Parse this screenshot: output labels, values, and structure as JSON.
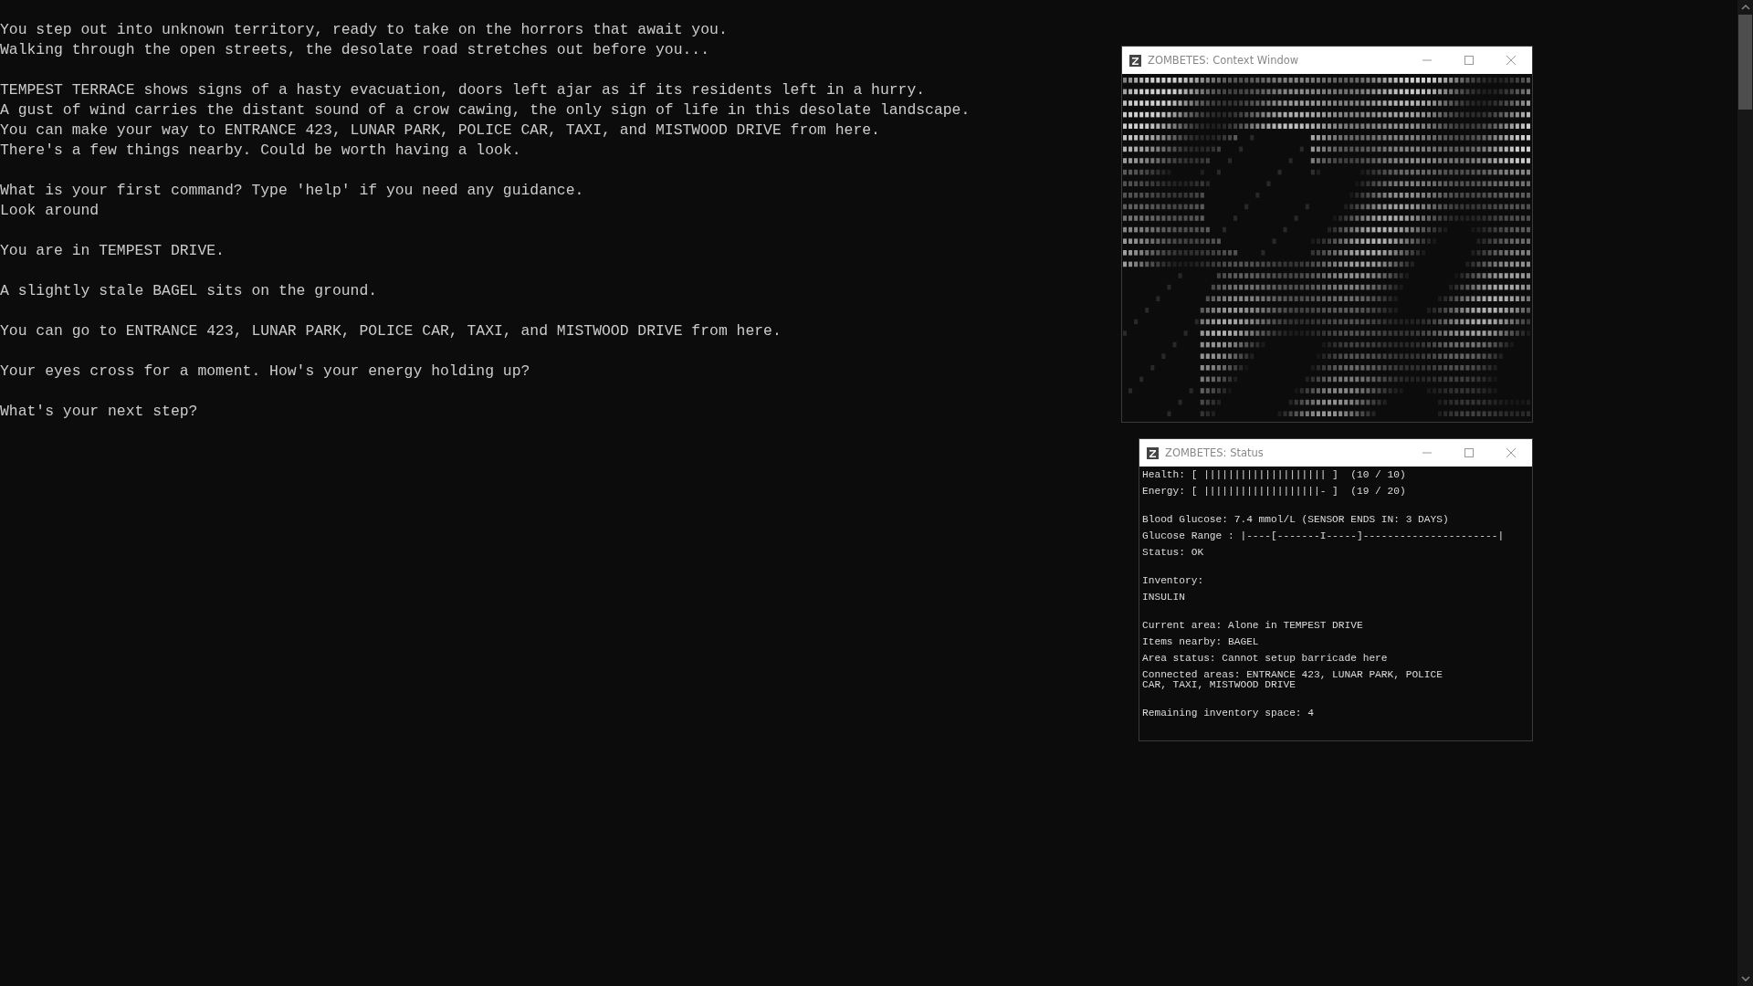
{
  "console": {
    "paragraphs": [
      [
        "You step out into unknown territory, ready to take on the horrors that await you.",
        "Walking through the open streets, the desolate road stretches out before you..."
      ],
      [
        "TEMPEST TERRACE shows signs of a hasty evacuation, doors left ajar as if its residents left in a hurry.",
        "A gust of wind carries the distant sound of a crow cawing, the only sign of life in this desolate landscape.",
        "You can make your way to ENTRANCE 423, LUNAR PARK, POLICE CAR, TAXI, and MISTWOOD DRIVE from here.",
        "There's a few things nearby. Could be worth having a look."
      ],
      [
        "What is your first command? Type 'help' if you need any guidance.",
        "Look around"
      ],
      [
        "You are in TEMPEST DRIVE."
      ],
      [
        "A slightly stale BAGEL sits on the ground."
      ],
      [
        "You can go to ENTRANCE 423, LUNAR PARK, POLICE CAR, TAXI, and MISTWOOD DRIVE from here."
      ],
      [
        "Your eyes cross for a moment. How's your energy holding up?"
      ],
      [
        "What's your next step?"
      ]
    ]
  },
  "context_window": {
    "title": "ZOMBETES: Context Window"
  },
  "status_window": {
    "title": "ZOMBETES: Status",
    "sections": [
      [
        {
          "kind": "meter",
          "text": "Health: [ |||||||||||||||||||| ]  (10 / 10)"
        },
        {
          "kind": "meter",
          "text": "Energy: [ |||||||||||||||||||- ]  (19 / 20)"
        }
      ],
      [
        {
          "kind": "text",
          "text": "Blood Glucose: 7.4 mmol/L (SENSOR ENDS IN: 3 DAYS)"
        },
        {
          "kind": "meter",
          "text": "Glucose Range : |----[-------I-----]----------------------|"
        },
        {
          "kind": "text",
          "text": "Status: OK"
        }
      ],
      [
        {
          "kind": "text",
          "text": "Inventory:"
        },
        {
          "kind": "text",
          "text": "INSULIN"
        }
      ],
      [
        {
          "kind": "text",
          "text": "Current area: Alone in TEMPEST DRIVE"
        },
        {
          "kind": "text",
          "text": "Items nearby: BAGEL"
        },
        {
          "kind": "text",
          "text": "Area status: Cannot setup barricade here"
        },
        {
          "kind": "text",
          "text": "Connected areas: ENTRANCE 423, LUNAR PARK, POLICE CAR, TAXI, MISTWOOD DRIVE"
        }
      ],
      [
        {
          "kind": "text",
          "text": "Remaining inventory space: 4"
        }
      ]
    ]
  }
}
